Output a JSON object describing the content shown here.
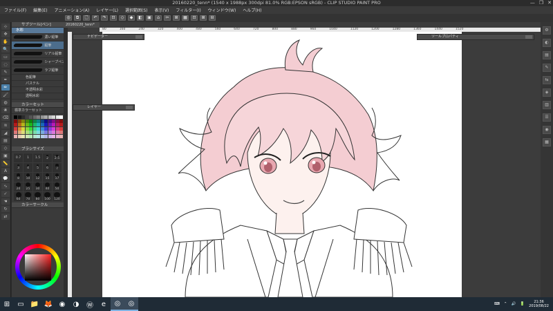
{
  "window": {
    "title": "20160220_tenn* (1540 x 1988px 300dpi 81.0%  RGB:EPSON  sRGB) - CLIP STUDIO PAINT PRO",
    "controls": [
      "—",
      "❐",
      "✕"
    ]
  },
  "menu": [
    "ファイル(F)",
    "編集(E)",
    "アニメーション(A)",
    "レイヤー(L)",
    "選択範囲(S)",
    "表示(V)",
    "フィルター(I)",
    "ウィンドウ(W)",
    "ヘルプ(H)"
  ],
  "command_icons": [
    "◎",
    "⧉",
    "🗋",
    "↶",
    "↷",
    "⊡",
    "◇",
    "◆",
    "◧",
    "▣",
    "⌂",
    "✂",
    "⊞",
    "▦",
    "⊡",
    "⊞",
    "⊟"
  ],
  "document": {
    "tab": "20160220_tenn*",
    "ruler_ticks": [
      "80",
      "160",
      "240",
      "320",
      "400",
      "480",
      "560",
      "640",
      "720",
      "800",
      "880",
      "960",
      "1040",
      "1120",
      "1200",
      "1280",
      "1360",
      "1440",
      "1520"
    ]
  },
  "left_panel": {
    "subtool_title": "サブツール[ペン]",
    "subtool_tab": "水彩",
    "brushes": [
      {
        "label": "濃い鉛筆",
        "selected": false
      },
      {
        "label": "鉛筆",
        "selected": true
      },
      {
        "label": "リアル鉛筆",
        "selected": false
      },
      {
        "label": "シャープペンシル",
        "selected": false
      },
      {
        "label": "ラフ鉛筆",
        "selected": false
      }
    ],
    "extra_items": [
      "色鉛筆",
      "パステル",
      "不透明水彩",
      "透明水彩"
    ],
    "color_set_title": "カラーセット",
    "color_set_name": "標準カラーセット",
    "brush_size_title": "ブラシサイズ",
    "sizes": [
      "0.7",
      "1",
      "1.5",
      "2",
      "2.5",
      "3",
      "4",
      "5",
      "6",
      "7",
      "8",
      "10",
      "12",
      "15",
      "17",
      "20",
      "25",
      "30",
      "40",
      "50",
      "60",
      "70",
      "80",
      "100",
      "120"
    ],
    "color_wheel_title": "カラーサークル"
  },
  "floating_panels": {
    "nav": "ナビゲーター",
    "layer": "レイヤー",
    "tool_prop": "ツールプロパティ"
  },
  "colors": {
    "accent": "#4a7fa8",
    "hair": "#f2c4c9",
    "eye": "#e8a7b0",
    "line": "#222222"
  },
  "right_icons": [
    "⚙",
    "◐",
    "▤",
    "✎",
    "⇆",
    "◈",
    "▥",
    "☰",
    "◉",
    "▦"
  ],
  "taskbar": {
    "apps": [
      {
        "icon": "⊞",
        "name": "start-icon",
        "active": false
      },
      {
        "icon": "▭",
        "name": "task-view-icon",
        "active": false
      },
      {
        "icon": "📁",
        "name": "explorer-icon",
        "active": false
      },
      {
        "icon": "🦊",
        "name": "firefox-icon",
        "active": false
      },
      {
        "icon": "◉",
        "name": "chrome-icon",
        "active": false
      },
      {
        "icon": "◑",
        "name": "app-icon",
        "active": false
      },
      {
        "icon": "Ⓦ",
        "name": "wacom-icon",
        "active": false
      },
      {
        "icon": "e",
        "name": "ie-icon",
        "active": false
      },
      {
        "icon": "◎",
        "name": "clip-studio-icon",
        "active": true
      },
      {
        "icon": "◎",
        "name": "clip-paint-icon",
        "active": true
      }
    ],
    "tray_icons": [
      "⌨",
      "⌃",
      "🔊",
      "🔋"
    ],
    "time": "21:36",
    "date": "2019/08/22"
  }
}
